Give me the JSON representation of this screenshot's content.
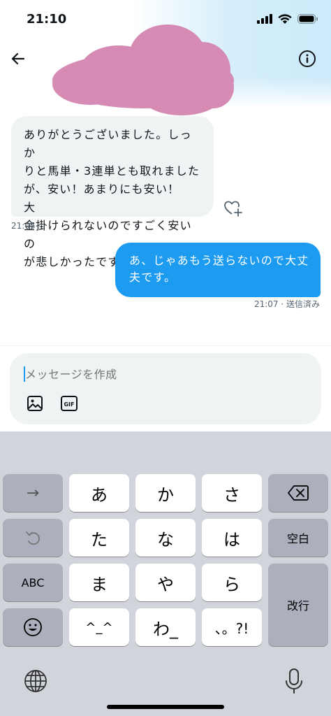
{
  "status_bar": {
    "time": "21:10"
  },
  "messages": {
    "incoming": {
      "lines": [
        "ありがとうございました。しっか",
        "りと馬単・3連単とも取れました",
        "が、安い！あまりにも安い！　大",
        "金掛けられないのですごく安いの",
        "が悲しかったですｗ"
      ],
      "time": "21:05"
    },
    "outgoing": {
      "lines": [
        "あ、じゃあもう送らないので大丈",
        "夫です。"
      ],
      "time_status": "21:07 · 送信済み"
    }
  },
  "composer": {
    "placeholder": "メッセージを作成",
    "gif_label": "GIF"
  },
  "keyboard": {
    "row1": [
      "→",
      "あ",
      "か",
      "さ"
    ],
    "row2": [
      "た",
      "な",
      "は"
    ],
    "row3": [
      "ABC",
      "ま",
      "や",
      "ら"
    ],
    "row4": [
      "^_^",
      "わ_",
      "、。?!"
    ],
    "space_label": "空白",
    "enter_label": "改行"
  },
  "colors": {
    "accent": "#1d9bf0",
    "bubble_in": "#eff3f4",
    "keyboard_bg": "#d1d4db",
    "redaction": "#d68bb4"
  }
}
